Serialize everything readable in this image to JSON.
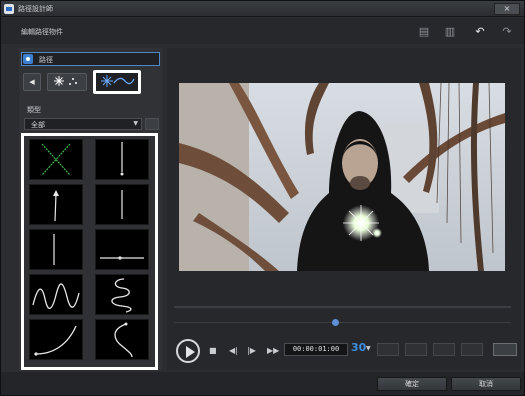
{
  "window": {
    "title": "路徑設計師",
    "close_icon": "close-icon"
  },
  "header": {
    "subtitle": "編輯路徑物件",
    "toolbar": [
      {
        "name": "copy-icon",
        "glyph": "⧉"
      },
      {
        "name": "paste-icon",
        "glyph": "⧉"
      },
      {
        "name": "undo-icon",
        "glyph": "↶"
      },
      {
        "name": "redo-icon",
        "glyph": "↷"
      }
    ]
  },
  "left": {
    "search_value": "路徑",
    "type_buttons": [
      {
        "name": "back-button",
        "glyph": "◀"
      },
      {
        "name": "particle-type-button",
        "glyph": "✳⁚"
      },
      {
        "name": "path-type-button",
        "glyph": "✺∿",
        "selected": true
      }
    ],
    "category_label": "類型",
    "category_value": "全部",
    "paths": [
      "cross",
      "vertical-down",
      "arrow-up",
      "vertical-line",
      "vertical-line-2",
      "horizontal-line",
      "wave",
      "spiral",
      "curve-up",
      "curve-s"
    ]
  },
  "player": {
    "timecode": "00:00:01:00",
    "fps": "30",
    "controls": {
      "stop": "■",
      "prev_frame": "◀|",
      "next_frame": "|▶",
      "fast_forward": "▶▶"
    }
  },
  "footer": {
    "ok_label": "確定",
    "cancel_label": "取消"
  },
  "colors": {
    "accent": "#3d8de0",
    "selection_frame": "#ffffff",
    "background": "#2b2d31"
  }
}
